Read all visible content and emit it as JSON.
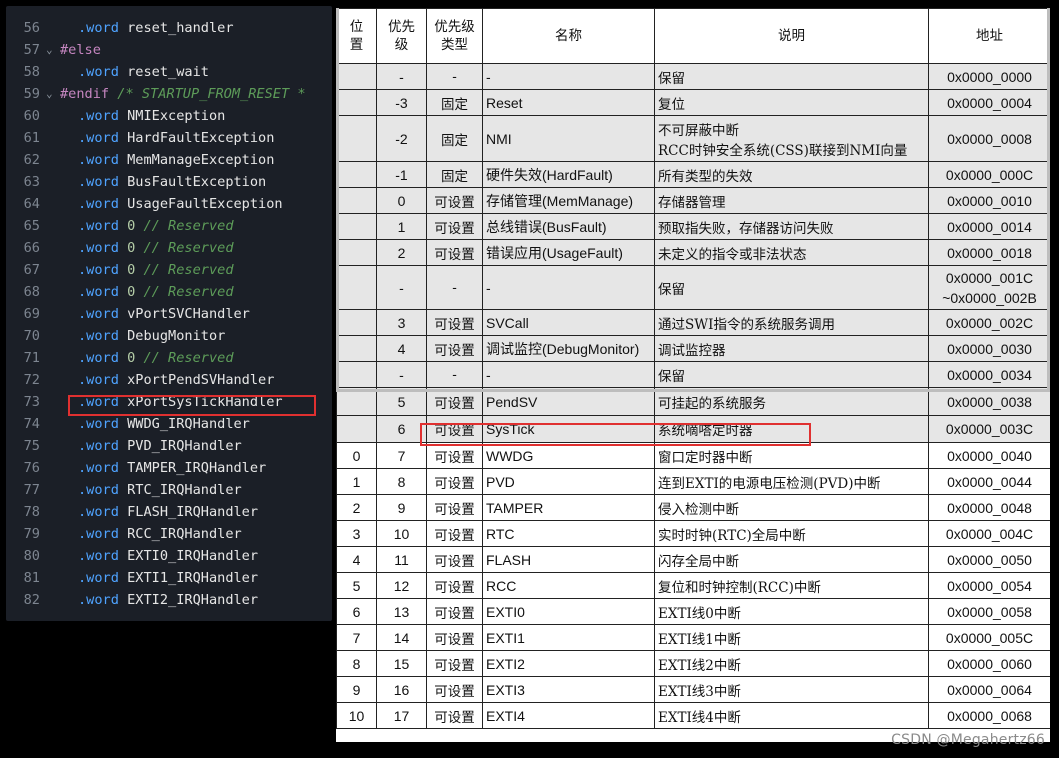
{
  "editor": {
    "lines": [
      {
        "num": "56",
        "fold": "",
        "indent": 1,
        "parts": [
          [
            "kw",
            ".word"
          ],
          [
            "id",
            " reset_handler"
          ]
        ]
      },
      {
        "num": "57",
        "fold": "⌄",
        "indent": 0,
        "parts": [
          [
            "pp",
            "#else"
          ]
        ]
      },
      {
        "num": "58",
        "fold": "",
        "indent": 1,
        "parts": [
          [
            "kw",
            ".word"
          ],
          [
            "id",
            " reset_wait"
          ]
        ]
      },
      {
        "num": "59",
        "fold": "⌄",
        "indent": 0,
        "parts": [
          [
            "pp",
            "#endif"
          ],
          [
            "cm",
            " /* STARTUP_FROM_RESET *"
          ]
        ]
      },
      {
        "num": "60",
        "fold": "",
        "indent": 1,
        "parts": [
          [
            "kw",
            ".word"
          ],
          [
            "id",
            " NMIException"
          ]
        ]
      },
      {
        "num": "61",
        "fold": "",
        "indent": 1,
        "parts": [
          [
            "kw",
            ".word"
          ],
          [
            "id",
            " HardFaultException"
          ]
        ]
      },
      {
        "num": "62",
        "fold": "",
        "indent": 1,
        "parts": [
          [
            "kw",
            ".word"
          ],
          [
            "id",
            " MemManageException"
          ]
        ]
      },
      {
        "num": "63",
        "fold": "",
        "indent": 1,
        "parts": [
          [
            "kw",
            ".word"
          ],
          [
            "id",
            " BusFaultException"
          ]
        ]
      },
      {
        "num": "64",
        "fold": "",
        "indent": 1,
        "parts": [
          [
            "kw",
            ".word"
          ],
          [
            "id",
            " UsageFaultException"
          ]
        ]
      },
      {
        "num": "65",
        "fold": "",
        "indent": 1,
        "parts": [
          [
            "kw",
            ".word"
          ],
          [
            "num",
            " 0"
          ],
          [
            "cm",
            " // Reserved"
          ]
        ]
      },
      {
        "num": "66",
        "fold": "",
        "indent": 1,
        "parts": [
          [
            "kw",
            ".word"
          ],
          [
            "num",
            " 0"
          ],
          [
            "cm",
            " // Reserved"
          ]
        ]
      },
      {
        "num": "67",
        "fold": "",
        "indent": 1,
        "parts": [
          [
            "kw",
            ".word"
          ],
          [
            "num",
            " 0"
          ],
          [
            "cm",
            " // Reserved"
          ]
        ]
      },
      {
        "num": "68",
        "fold": "",
        "indent": 1,
        "parts": [
          [
            "kw",
            ".word"
          ],
          [
            "num",
            " 0"
          ],
          [
            "cm",
            " // Reserved"
          ]
        ]
      },
      {
        "num": "69",
        "fold": "",
        "indent": 1,
        "parts": [
          [
            "kw",
            ".word"
          ],
          [
            "id",
            " vPortSVCHandler"
          ]
        ]
      },
      {
        "num": "70",
        "fold": "",
        "indent": 1,
        "parts": [
          [
            "kw",
            ".word"
          ],
          [
            "id",
            " DebugMonitor"
          ]
        ]
      },
      {
        "num": "71",
        "fold": "",
        "indent": 1,
        "parts": [
          [
            "kw",
            ".word"
          ],
          [
            "num",
            " 0"
          ],
          [
            "cm",
            " // Reserved"
          ]
        ]
      },
      {
        "num": "72",
        "fold": "",
        "indent": 1,
        "parts": [
          [
            "kw",
            ".word"
          ],
          [
            "id",
            " xPortPendSVHandler"
          ]
        ]
      },
      {
        "num": "73",
        "fold": "",
        "indent": 1,
        "parts": [
          [
            "kw",
            ".word"
          ],
          [
            "id",
            " xPortSysTickHandler"
          ]
        ]
      },
      {
        "num": "74",
        "fold": "",
        "indent": 1,
        "parts": [
          [
            "kw",
            ".word"
          ],
          [
            "id",
            " WWDG_IRQHandler"
          ]
        ]
      },
      {
        "num": "75",
        "fold": "",
        "indent": 1,
        "parts": [
          [
            "kw",
            ".word"
          ],
          [
            "id",
            " PVD_IRQHandler"
          ]
        ]
      },
      {
        "num": "76",
        "fold": "",
        "indent": 1,
        "parts": [
          [
            "kw",
            ".word"
          ],
          [
            "id",
            " TAMPER_IRQHandler"
          ]
        ]
      },
      {
        "num": "77",
        "fold": "",
        "indent": 1,
        "parts": [
          [
            "kw",
            ".word"
          ],
          [
            "id",
            " RTC_IRQHandler"
          ]
        ]
      },
      {
        "num": "78",
        "fold": "",
        "indent": 1,
        "parts": [
          [
            "kw",
            ".word"
          ],
          [
            "id",
            " FLASH_IRQHandler"
          ]
        ]
      },
      {
        "num": "79",
        "fold": "",
        "indent": 1,
        "parts": [
          [
            "kw",
            ".word"
          ],
          [
            "id",
            " RCC_IRQHandler"
          ]
        ]
      },
      {
        "num": "80",
        "fold": "",
        "indent": 1,
        "parts": [
          [
            "kw",
            ".word"
          ],
          [
            "id",
            " EXTI0_IRQHandler"
          ]
        ]
      },
      {
        "num": "81",
        "fold": "",
        "indent": 1,
        "parts": [
          [
            "kw",
            ".word"
          ],
          [
            "id",
            " EXTI1_IRQHandler"
          ]
        ]
      },
      {
        "num": "82",
        "fold": "",
        "indent": 1,
        "parts": [
          [
            "kw",
            ".word"
          ],
          [
            "id",
            " EXTI2_IRQHandler"
          ]
        ]
      }
    ],
    "highlight_line": "73",
    "colors": {
      "background": "#1b1f27",
      "keyword": "#4fa3ff",
      "comment": "#5d9c59",
      "highlight": "#e03030"
    }
  },
  "table": {
    "headers": [
      "位\n置",
      "优先\n级",
      "优先级\n类型",
      "名称",
      "说明",
      "地址"
    ],
    "rows": [
      {
        "pos": "",
        "prio": "-",
        "type": "-",
        "name": "-",
        "desc": "保留",
        "addr": "0x0000_0000",
        "grey": true
      },
      {
        "pos": "",
        "prio": "-3",
        "type": "固定",
        "name": "Reset",
        "desc": "复位",
        "addr": "0x0000_0004",
        "grey": true
      },
      {
        "pos": "",
        "prio": "-2",
        "type": "固定",
        "name": "NMI",
        "desc": "不可屏蔽中断\nRCC时钟安全系统(CSS)联接到NMI向量",
        "addr": "0x0000_0008",
        "grey": true
      },
      {
        "pos": "",
        "prio": "-1",
        "type": "固定",
        "name": "硬件失效(HardFault)",
        "desc": "所有类型的失效",
        "addr": "0x0000_000C",
        "grey": true
      },
      {
        "pos": "",
        "prio": "0",
        "type": "可设置",
        "name": "存储管理(MemManage)",
        "desc": "存储器管理",
        "addr": "0x0000_0010",
        "grey": true
      },
      {
        "pos": "",
        "prio": "1",
        "type": "可设置",
        "name": "总线错误(BusFault)",
        "desc": "预取指失败，存储器访问失败",
        "addr": "0x0000_0014",
        "grey": true
      },
      {
        "pos": "",
        "prio": "2",
        "type": "可设置",
        "name": "错误应用(UsageFault)",
        "desc": "未定义的指令或非法状态",
        "addr": "0x0000_0018",
        "grey": true
      },
      {
        "pos": "",
        "prio": "-",
        "type": "-",
        "name": "-",
        "desc": "保留",
        "addr": "0x0000_001C\n~0x0000_002B",
        "grey": true
      },
      {
        "pos": "",
        "prio": "3",
        "type": "可设置",
        "name": "SVCall",
        "desc": "通过SWI指令的系统服务调用",
        "addr": "0x0000_002C",
        "grey": true
      },
      {
        "pos": "",
        "prio": "4",
        "type": "可设置",
        "name": "调试监控(DebugMonitor)",
        "desc": "调试监控器",
        "addr": "0x0000_0030",
        "grey": true
      },
      {
        "pos": "",
        "prio": "-",
        "type": "-",
        "name": "-",
        "desc": "保留",
        "addr": "0x0000_0034",
        "grey": true
      },
      {
        "pos": "",
        "prio": "5",
        "type": "可设置",
        "name": "PendSV",
        "desc": "可挂起的系统服务",
        "addr": "0x0000_0038",
        "grey": true
      },
      {
        "pos": "",
        "prio": "6",
        "type": "可设置",
        "name": "SysTick",
        "desc": "系统嘀嗒定时器",
        "addr": "0x0000_003C",
        "grey": true
      },
      {
        "pos": "0",
        "prio": "7",
        "type": "可设置",
        "name": "WWDG",
        "desc": "窗口定时器中断",
        "addr": "0x0000_0040",
        "grey": false
      },
      {
        "pos": "1",
        "prio": "8",
        "type": "可设置",
        "name": "PVD",
        "desc": "连到EXTI的电源电压检测(PVD)中断",
        "addr": "0x0000_0044",
        "grey": false
      },
      {
        "pos": "2",
        "prio": "9",
        "type": "可设置",
        "name": "TAMPER",
        "desc": "侵入检测中断",
        "addr": "0x0000_0048",
        "grey": false
      },
      {
        "pos": "3",
        "prio": "10",
        "type": "可设置",
        "name": "RTC",
        "desc": "实时时钟(RTC)全局中断",
        "addr": "0x0000_004C",
        "grey": false
      },
      {
        "pos": "4",
        "prio": "11",
        "type": "可设置",
        "name": "FLASH",
        "desc": "闪存全局中断",
        "addr": "0x0000_0050",
        "grey": false
      },
      {
        "pos": "5",
        "prio": "12",
        "type": "可设置",
        "name": "RCC",
        "desc": "复位和时钟控制(RCC)中断",
        "addr": "0x0000_0054",
        "grey": false
      },
      {
        "pos": "6",
        "prio": "13",
        "type": "可设置",
        "name": "EXTI0",
        "desc": "EXTI线0中断",
        "addr": "0x0000_0058",
        "grey": false
      },
      {
        "pos": "7",
        "prio": "14",
        "type": "可设置",
        "name": "EXTI1",
        "desc": "EXTI线1中断",
        "addr": "0x0000_005C",
        "grey": false
      },
      {
        "pos": "8",
        "prio": "15",
        "type": "可设置",
        "name": "EXTI2",
        "desc": "EXTI线2中断",
        "addr": "0x0000_0060",
        "grey": false
      },
      {
        "pos": "9",
        "prio": "16",
        "type": "可设置",
        "name": "EXTI3",
        "desc": "EXTI线3中断",
        "addr": "0x0000_0064",
        "grey": false
      },
      {
        "pos": "10",
        "prio": "17",
        "type": "可设置",
        "name": "EXTI4",
        "desc": "EXTI线4中断",
        "addr": "0x0000_0068",
        "grey": false
      }
    ],
    "colors": {
      "grey_row": "#e6e6e6",
      "highlight": "#e03030"
    }
  },
  "watermark": "CSDN @Megahertz66"
}
